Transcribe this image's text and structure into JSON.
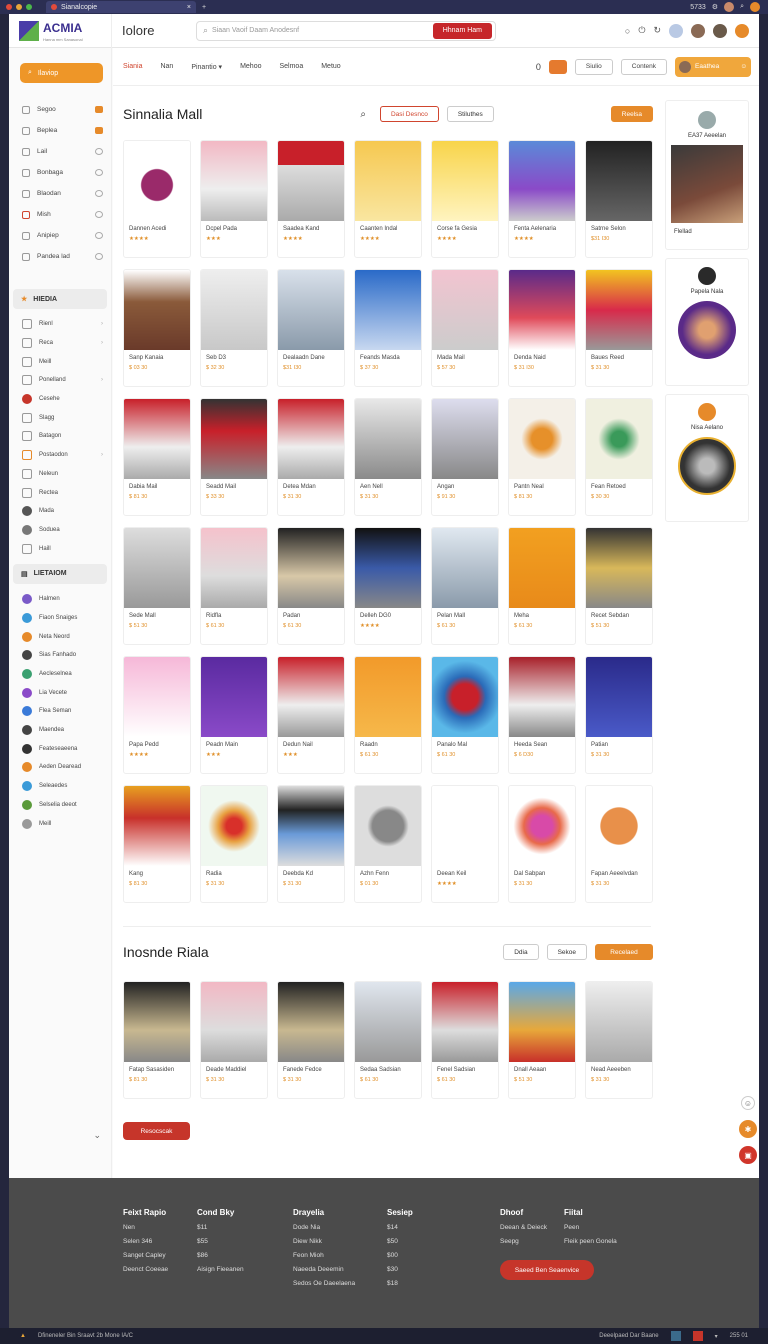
{
  "browser": {
    "tab_title": "Sianalcopie",
    "clock": "5733"
  },
  "app": {
    "logo": "ACMIA",
    "logo_sub": "Hanna mm Sanasonal",
    "title": "Iolore"
  },
  "search": {
    "placeholder": "Siaan Vaoif Daam Anodesnf",
    "button": "Hhnam Ham"
  },
  "nav": {
    "tabs": [
      "Siania",
      "Nan",
      "Pinantio",
      "Mehoo",
      "Selmoa",
      "Metuo"
    ],
    "count": "0",
    "btn1": "Siulio",
    "btn2": "Contenk",
    "user": "Eaathea"
  },
  "sidebar": {
    "search": "Ilaviop",
    "items": [
      "Segoo",
      "Beplea",
      "Lail",
      "Bonbaga",
      "Blaodan",
      "Mish",
      "Anipiep",
      "Pandea lad"
    ],
    "section1": "HIEDIA",
    "sub1": [
      "Rienl",
      "Reca",
      "Meill",
      "Ponelland",
      "Cesehe",
      "Slagg",
      "Batagon",
      "Postaodon",
      "Neleun",
      "Rectea",
      "Mada",
      "Soduea",
      "Haill"
    ],
    "section2": "LIETAIOM",
    "sub2": [
      "Halmen",
      "Fiaon Snaiges",
      "Neta Neord",
      "Sias Fanhado",
      "Aecleselnea",
      "Lia Vecete",
      "Flea Seman",
      "Maendea",
      "Feateseaeena",
      "Aeden Dearead",
      "Seleaedes",
      "Selselia deeot",
      "Meill"
    ]
  },
  "section1": {
    "title": "Sinnalia Mall",
    "tab_active": "Dasi Desnco",
    "tab_other": "Stiluthes",
    "action": "Reelsa"
  },
  "cards1": [
    {
      "name": "Dannen Acedi",
      "sub": "★★★★"
    },
    {
      "name": "Dcpel Pada",
      "sub": "★★★"
    },
    {
      "name": "Saadea Kand",
      "sub": "★★★★"
    },
    {
      "name": "Caanten Indal",
      "sub": "★★★★"
    },
    {
      "name": "Corse fa Gesia",
      "sub": "★★★★"
    },
    {
      "name": "Fenta Aelenaria",
      "sub": "★★★★"
    },
    {
      "name": "Satrne Selon",
      "sub": "$31 I30"
    },
    {
      "name": "Sanp Kanaia",
      "sub": "$ 03 30"
    },
    {
      "name": "Seb D3",
      "sub": "$ 32 30"
    },
    {
      "name": "Dealaadn Dane",
      "sub": "$31 I30"
    },
    {
      "name": "Feands Masda",
      "sub": "$ 37 30"
    },
    {
      "name": "Mada Mail",
      "sub": "$ 57 30"
    },
    {
      "name": "Denda Naid",
      "sub": "$ 31 I30"
    },
    {
      "name": "Baues Reed",
      "sub": "$ 31 30"
    },
    {
      "name": "Dabia Mail",
      "sub": "$ 81 30"
    },
    {
      "name": "Seadd Mail",
      "sub": "$ 33 30"
    },
    {
      "name": "Detea Mdan",
      "sub": "$ 31 30"
    },
    {
      "name": "Aen Nell",
      "sub": "$ 31 30"
    },
    {
      "name": "Angan",
      "sub": "$ 91 30"
    },
    {
      "name": "Pantn Neal",
      "sub": "$ 81 30"
    },
    {
      "name": "Fean Retoed",
      "sub": "$ 30 30"
    },
    {
      "name": "Sede Mall",
      "sub": "$ 51 30"
    },
    {
      "name": "Ridfla",
      "sub": "$ 61 30"
    },
    {
      "name": "Padan",
      "sub": "$ 61 30"
    },
    {
      "name": "Delleh DG0",
      "sub": "★★★★"
    },
    {
      "name": "Pelan Mall",
      "sub": "$ 61 30"
    },
    {
      "name": "Meha",
      "sub": "$ 61 30"
    },
    {
      "name": "Recet Sebdan",
      "sub": "$ 51 30"
    },
    {
      "name": "Papa Pedd",
      "sub": "★★★★"
    },
    {
      "name": "Peadn Main",
      "sub": "★★★"
    },
    {
      "name": "Dedun Nail",
      "sub": "★★★"
    },
    {
      "name": "Raadn",
      "sub": "$ 61 30"
    },
    {
      "name": "Panalo Mal",
      "sub": "$ 61 30"
    },
    {
      "name": "Heeda Sean",
      "sub": "$ 6 D30"
    },
    {
      "name": "Patian",
      "sub": "$ 31 30"
    },
    {
      "name": "Kang",
      "sub": "$ 81 30"
    },
    {
      "name": "Radia",
      "sub": "$ 31 30"
    },
    {
      "name": "Deebda Kd",
      "sub": "$ 31 30"
    },
    {
      "name": "Azhn Fenn",
      "sub": "$ 01 30"
    },
    {
      "name": "Deean Keil",
      "sub": "★★★★"
    },
    {
      "name": "Dal Sabpan",
      "sub": "$ 31 30"
    },
    {
      "name": "Fapan Aeeelvdan",
      "sub": "$ 31 30"
    }
  ],
  "section2": {
    "title": "Inosnde Riala",
    "btn1": "Ddia",
    "btn2": "Sekoe",
    "btn3": "Recelaed",
    "cta": "Resocscak"
  },
  "cards2": [
    {
      "name": "Fatap Sasasiden",
      "sub": "$ 81 30"
    },
    {
      "name": "Deade Maddiel",
      "sub": "$ 31 30"
    },
    {
      "name": "Fanede Fedce",
      "sub": "$ 31 30"
    },
    {
      "name": "Sedaa Sadsian",
      "sub": "$ 61 30"
    },
    {
      "name": "Fenel Sadsian",
      "sub": "$ 61 30"
    },
    {
      "name": "Dnall Aeaan",
      "sub": "$ 51 30"
    },
    {
      "name": "Nead Aeeeben",
      "sub": "$ 31 30"
    }
  ],
  "right_panel": {
    "card1_title": "EA37 Aeeelan",
    "card1_foot": "Flellad",
    "card2_title": "Papela Nala",
    "card3_title": "Nisa Aelano"
  },
  "footer": {
    "cols": [
      {
        "title": "Feixt Rapio",
        "items": [
          "Nen",
          "Selen 346",
          "Sanget Capley",
          "Deenct Coeeae"
        ]
      },
      {
        "title": "Cond Bky",
        "items": [
          "$11",
          "$55",
          "$86",
          "Aisign Fieeanen"
        ]
      },
      {
        "title": "Drayelia",
        "items": [
          "Dode Nia",
          "Diew Nikk",
          "Feon Mioh",
          "Naeeda Deeemin",
          "Sedos Oe Daeelaena"
        ]
      },
      {
        "title": "Sesiep",
        "items": [
          "$14",
          "$50",
          "$00",
          "$30",
          "$18"
        ]
      },
      {
        "title": "Dhoof",
        "items": [
          "Deean & Deieck",
          "Seepg"
        ]
      },
      {
        "title": "Fiital",
        "items": [
          "Peen",
          "Fleik peen Gonela"
        ]
      }
    ],
    "cta": "Saeed Ben Seaenvice"
  },
  "taskbar": {
    "left": "Dfineneler Bin Sraavt   2b Mone IA/C",
    "right": "Deeelpaed Dar Baane",
    "time": "255 01"
  }
}
